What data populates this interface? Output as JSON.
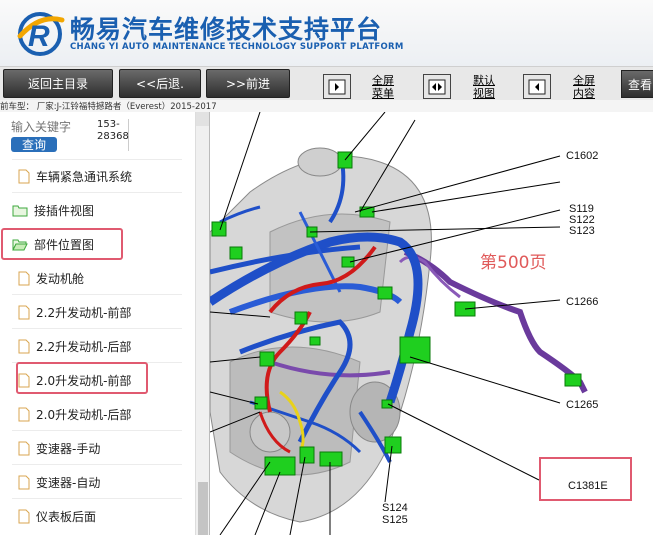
{
  "header": {
    "title_cn": "畅易汽车维修技术支持平台",
    "title_en": "CHANG YI AUTO MAINTENANCE TECHNOLOGY SUPPORT PLATFORM"
  },
  "toolbar": {
    "home_label": "返回主目录",
    "back_label": "<<后退.",
    "forward_label": ">>前进",
    "fullscreen_menu": [
      "全屏",
      "菜单"
    ],
    "default_view": [
      "默认",
      "视图"
    ],
    "fullscreen_content": [
      "全屏",
      "内容"
    ],
    "view_label": "查看"
  },
  "breadcrumb": "前车型：  厂家:J-江铃福特撼路者（Everest）2015-2017",
  "sidebar": {
    "search_placeholder": "输入关键字",
    "search_button": "查询",
    "code": [
      "153-",
      "28368"
    ],
    "items": [
      {
        "label": "车辆紧急通讯系统",
        "type": "doc"
      },
      {
        "label": "接插件视图",
        "type": "folder"
      },
      {
        "label": "部件位置图",
        "type": "folder-open"
      },
      {
        "label": "发动机舱",
        "type": "doc"
      },
      {
        "label": "2.2升发动机-前部",
        "type": "doc"
      },
      {
        "label": "2.2升发动机-后部",
        "type": "doc"
      },
      {
        "label": "2.0升发动机-前部",
        "type": "doc"
      },
      {
        "label": "2.0升发动机-后部",
        "type": "doc"
      },
      {
        "label": "变速器-手动",
        "type": "doc"
      },
      {
        "label": "变速器-自动",
        "type": "doc"
      },
      {
        "label": "仪表板后面",
        "type": "doc"
      }
    ]
  },
  "diagram": {
    "page_label": "第500页",
    "callouts": [
      "C1602",
      "S119",
      "S122",
      "S123",
      "C1266",
      "C1265",
      "C1381E",
      "S124",
      "S125"
    ]
  },
  "colors": {
    "brand_blue": "#1a5fb0",
    "harness_blue": "#1f4fc8",
    "harness_red": "#d01a1a",
    "harness_purple": "#6a3a9c",
    "connector_green": "#1fcf1f",
    "highlight_red": "#e05a70"
  }
}
